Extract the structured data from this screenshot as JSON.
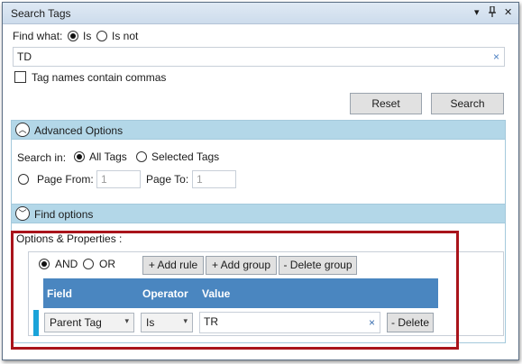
{
  "window": {
    "title": "Search Tags",
    "dropdown_glyph": "▾",
    "pin_glyph": "📌",
    "close_glyph": "✕"
  },
  "find": {
    "label": "Find what:",
    "is_label": "Is",
    "isnot_label": "Is not",
    "selected": "Is",
    "value": "TD",
    "clear_glyph": "×",
    "commas_label": "Tag names contain commas",
    "commas_checked": false
  },
  "buttons": {
    "reset": "Reset",
    "search": "Search"
  },
  "advanced": {
    "header": "Advanced Options",
    "search_in_label": "Search in:",
    "all_tags": "All Tags",
    "selected_tags": "Selected Tags",
    "search_in_selected": "All Tags",
    "page_from_label": "Page From:",
    "page_from_value": "1",
    "page_to_label": "Page To:",
    "page_to_value": "1"
  },
  "find_options": {
    "header": "Find options",
    "props_label": "Options & Properties :",
    "and_label": "AND",
    "or_label": "OR",
    "logic_selected": "AND",
    "add_rule": "+ Add rule",
    "add_group": "+ Add group",
    "delete_group": "- Delete group",
    "columns": [
      "Field",
      "Operator",
      "Value"
    ],
    "rule": {
      "field": "Parent Tag",
      "operator": "Is",
      "value": "TR",
      "delete": "- Delete"
    }
  },
  "colors": {
    "section_header": "#b3d7e8",
    "grid_header": "#4a86c0",
    "highlight": "#a9141b",
    "row_marker": "#1aa3d9"
  }
}
